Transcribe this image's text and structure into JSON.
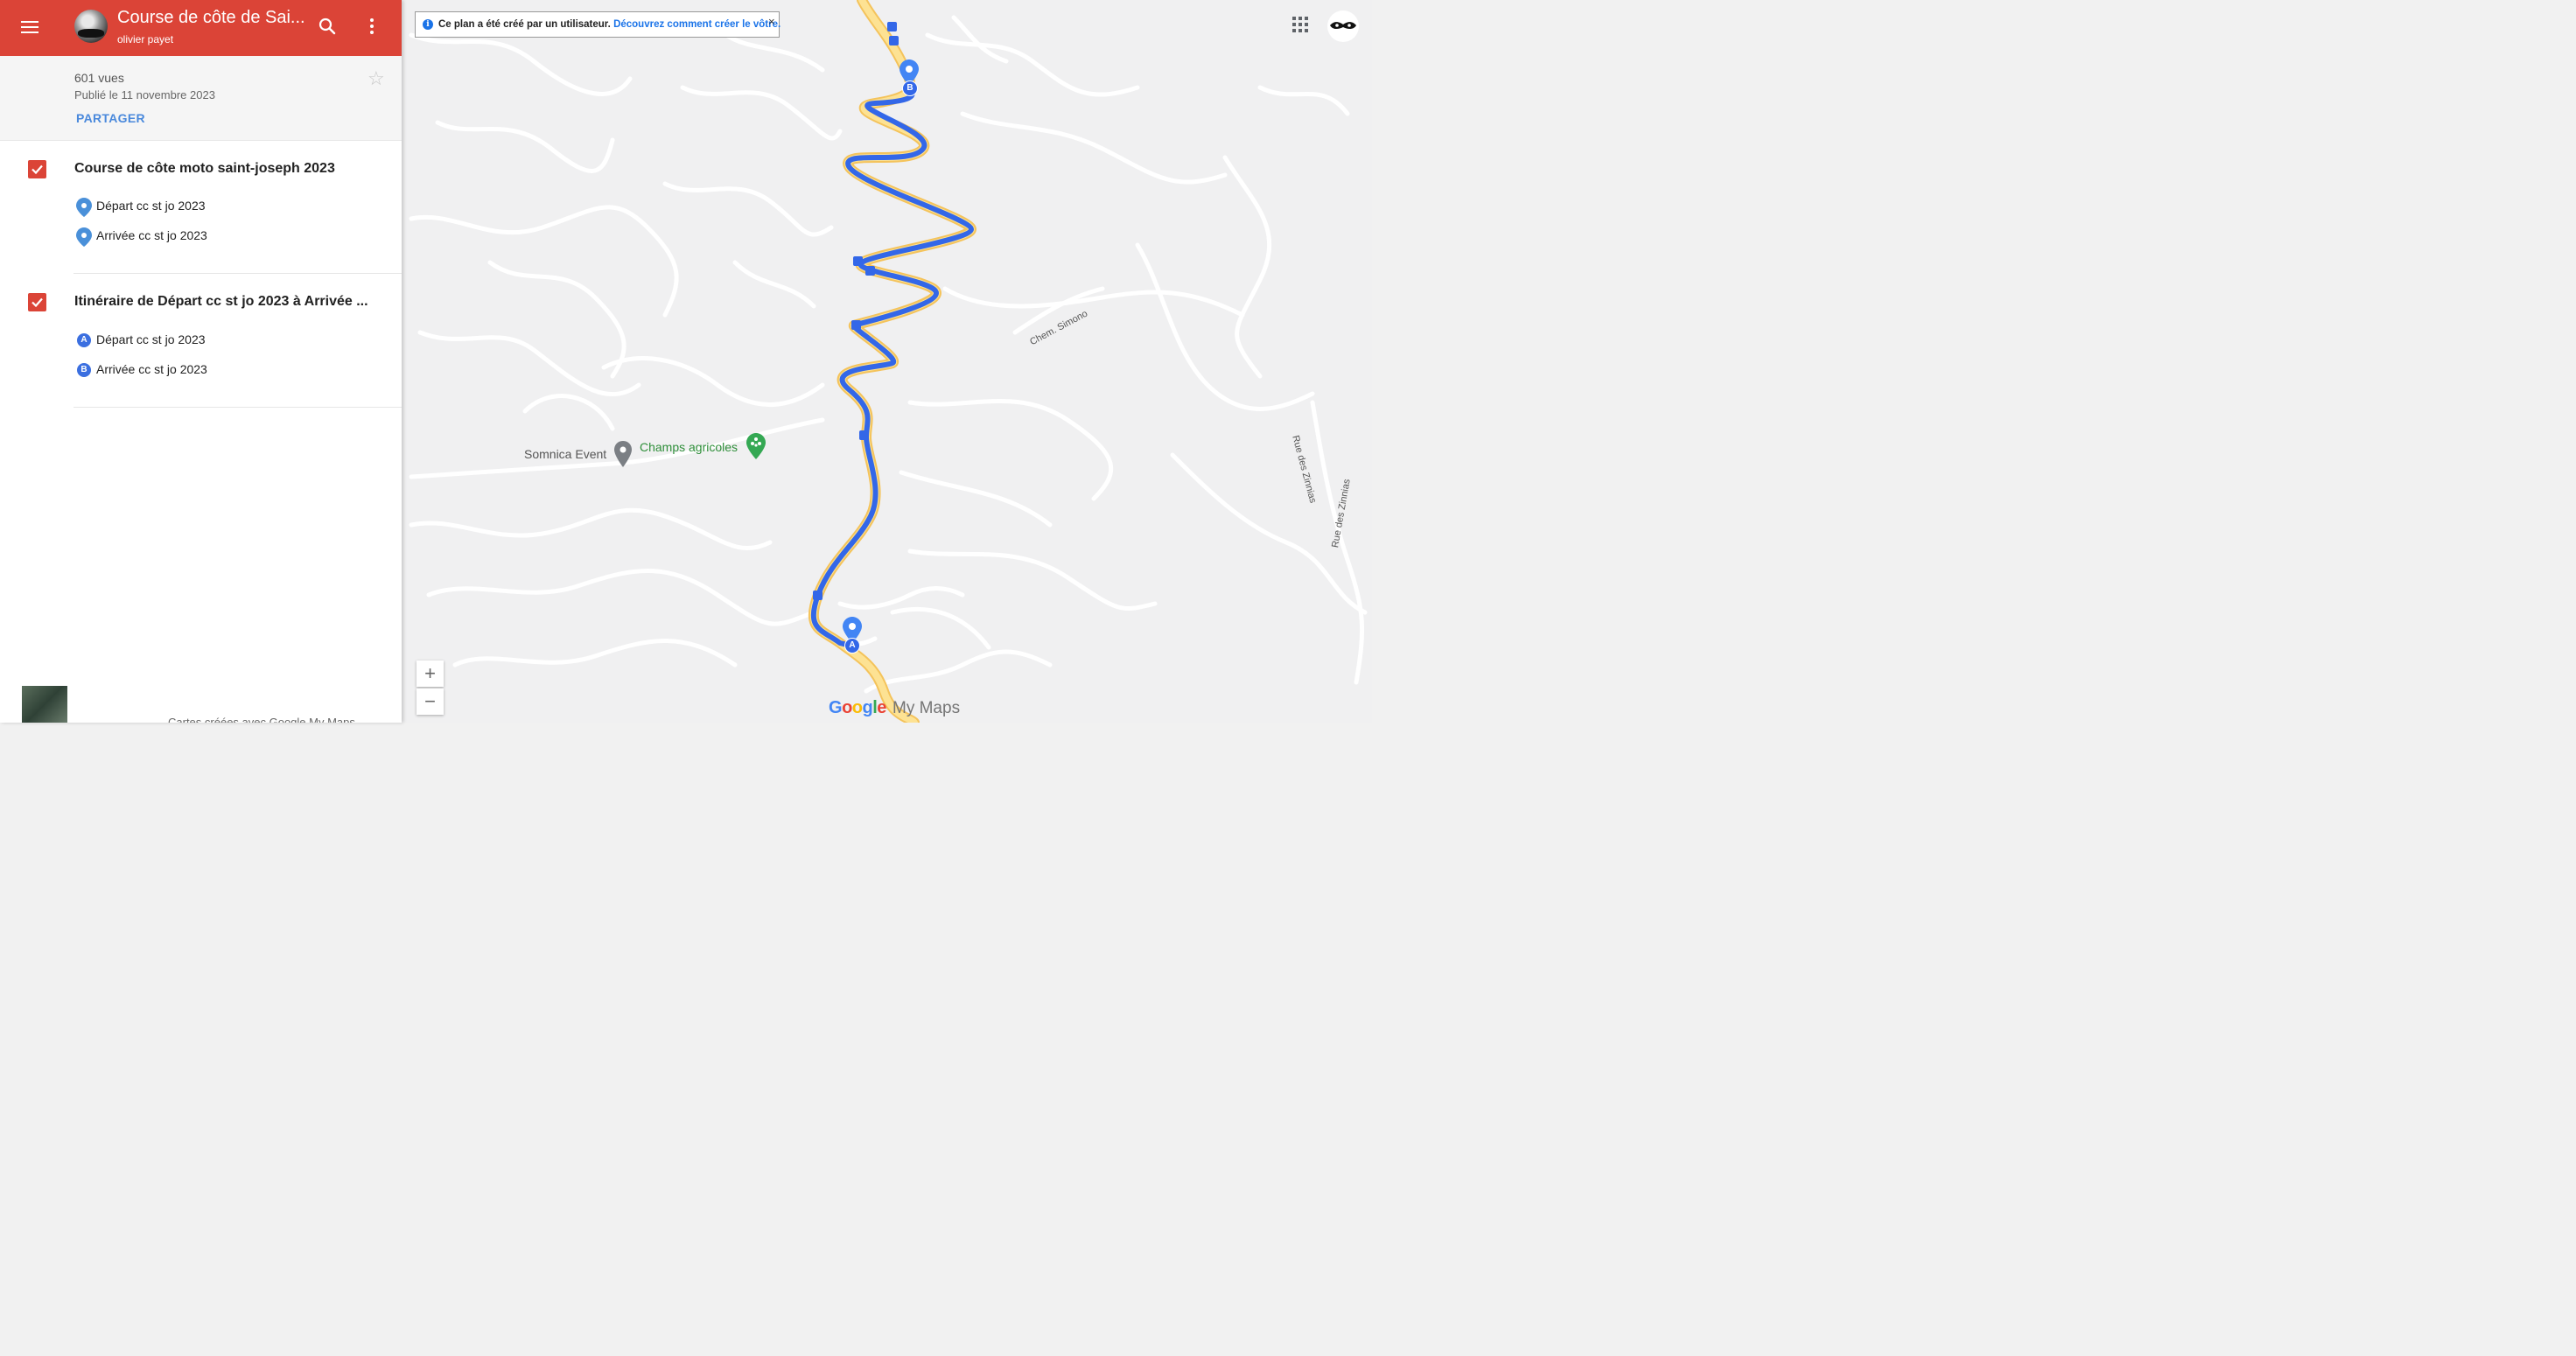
{
  "header": {
    "title": "Course de côte de Sai...",
    "owner": "olivier payet"
  },
  "meta": {
    "views": "601 vues",
    "published": "Publié le 11 novembre 2023",
    "share_label": "PARTAGER"
  },
  "layers": [
    {
      "title": "Course de côte moto saint-joseph 2023",
      "items": [
        {
          "label": "Départ cc st jo 2023",
          "icon": "map-pin-icon"
        },
        {
          "label": "Arrivée cc st jo 2023",
          "icon": "map-pin-icon"
        }
      ]
    },
    {
      "title": "Itinéraire de Départ cc st jo 2023 à Arrivée ...",
      "items": [
        {
          "label": "Départ cc st jo 2023",
          "icon": "A"
        },
        {
          "label": "Arrivée cc st jo 2023",
          "icon": "B"
        }
      ]
    }
  ],
  "footer": {
    "note": "Cartes créées avec Google My Maps"
  },
  "map": {
    "banner_text": "Ce plan a été créé par un utilisateur.",
    "banner_link": "Découvrez comment créer le vôtre.",
    "close_symbol": "×",
    "zoom_in": "+",
    "zoom_out": "−",
    "places": [
      {
        "name": "Somnica Event"
      },
      {
        "name": "Champs agricoles"
      }
    ],
    "roads": {
      "simono": "Chem. Simono",
      "zinnias_1": "Rue des Zinnias",
      "zinnias_2": "Rue des Zinnias"
    },
    "marker_a": "A",
    "marker_b": "B",
    "logo_google": [
      "G",
      "o",
      "o",
      "g",
      "l",
      "e"
    ],
    "logo_mymaps": "My Maps",
    "route_color": "#3367e8",
    "accent_color": "#db4437"
  }
}
